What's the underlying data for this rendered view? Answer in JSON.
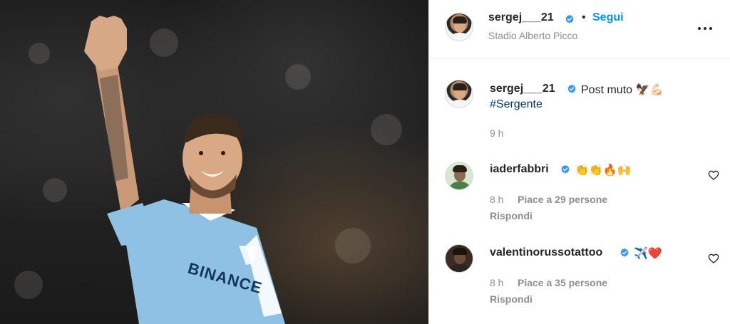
{
  "header": {
    "username": "sergej___21",
    "separator": "•",
    "follow_label": "Segui",
    "location": "Stadio Alberto Picco",
    "more_icon": "more-horizontal-icon"
  },
  "caption": {
    "username": "sergej___21",
    "text": "Post muto 🦅💪🏻",
    "hashtag": "#Sergente",
    "time": "9 h"
  },
  "comments": [
    {
      "username": "iaderfabbri",
      "text": "👏👏🔥🙌",
      "time": "8 h",
      "likes": "Piace a 29 persone",
      "reply": "Rispondi"
    },
    {
      "username": "valentinorussotattoo",
      "text": "✈️❤️",
      "time": "8 h",
      "likes": "Piace a 35 persone",
      "reply": "Rispondi"
    }
  ],
  "photo": {
    "jersey_text": "BINANCE"
  },
  "colors": {
    "accent": "#0095f6",
    "verified": "#3897f0",
    "hashtag": "#00376b",
    "muted": "#8e8e8e"
  }
}
